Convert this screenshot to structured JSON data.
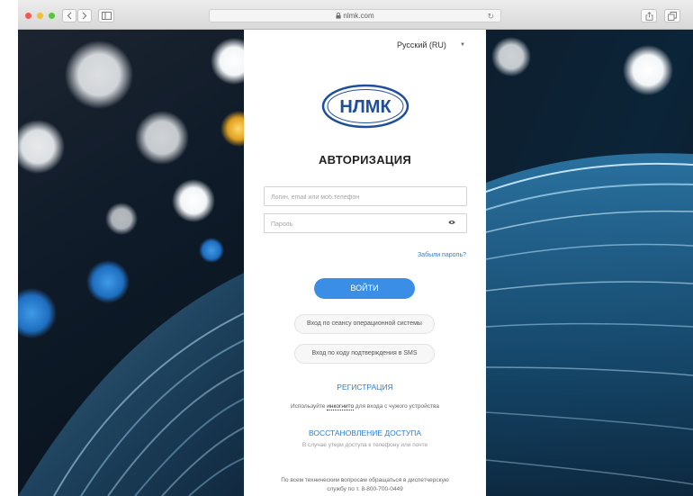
{
  "browser": {
    "url": "nlmk.com"
  },
  "login": {
    "language": "Русский (RU)",
    "logo_text": "НЛМК",
    "title": "АВТОРИЗАЦИЯ",
    "login_placeholder": "Логин, email или моб.телефон",
    "password_placeholder": "Пароль",
    "forgot_link": "Забыли пароль?",
    "submit_label": "ВОЙТИ",
    "os_session_button": "Вход по сеансу операционной системы",
    "sms_code_button": "Вход по коду подтверждения в SMS",
    "register_link": "РЕГИСТРАЦИЯ",
    "incognito_prefix": "Используйте ",
    "incognito_word": "инкогнито",
    "incognito_suffix": " для входа с чужого устройства",
    "restore_link": "ВОССТАНОВЛЕНИЕ ДОСТУПА",
    "restore_hint": "В случае утери доступа к телефону или почте",
    "support_line1": "По всем техническим вопросам обращаться в диспетчерскую",
    "support_line2": "службу по т. 8-800-700-0449"
  },
  "colors": {
    "accent": "#3a8ee6",
    "link": "#2d7ed1",
    "logo": "#1f4e9a"
  }
}
